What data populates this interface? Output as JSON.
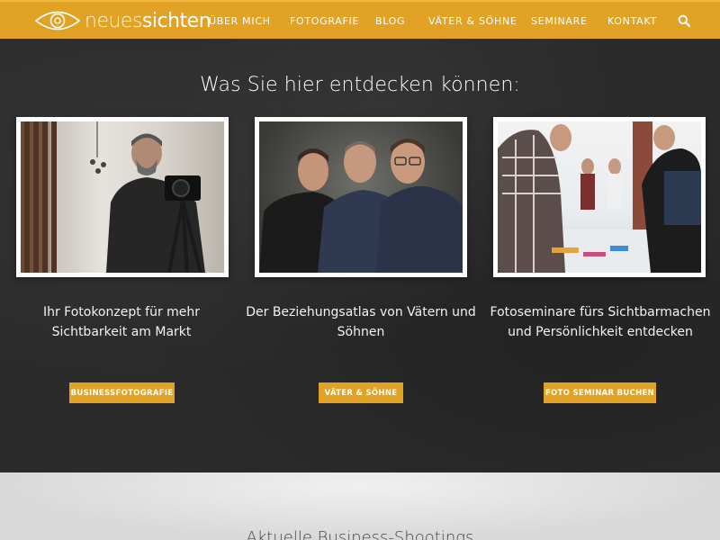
{
  "brand": {
    "name_part1": "neues",
    "name_part2": "sichten"
  },
  "nav": {
    "items": [
      {
        "label": "ÜBER MICH"
      },
      {
        "label": "FOTOGRAFIE"
      },
      {
        "label": "BLOG"
      },
      {
        "label": "VÄTER & SÖHNE"
      },
      {
        "label": "SEMINARE"
      },
      {
        "label": "KONTAKT"
      }
    ],
    "search_icon": "search-icon"
  },
  "intro": {
    "title": "Was Sie hier entdecken können:"
  },
  "cards": [
    {
      "text": "Ihr Fotokonzept für mehr Sichtbarkeit am Markt",
      "button": "BUSINESSFOTOGRAFIE"
    },
    {
      "text": "Der Beziehungsatlas von Vätern und Söhnen",
      "button": "VÄTER & SÖHNE"
    },
    {
      "text": "Fotoseminare fürs Sichtbarmachen und Persönlichkeit entdecken",
      "button": "FOTO SEMINAR BUCHEN"
    }
  ],
  "next_section": {
    "title": "Aktuelle Business-Shootings"
  },
  "colors": {
    "accent": "#e1a226",
    "dark_bg": "#2b2b2b",
    "light_bg": "#e3e3e3"
  }
}
